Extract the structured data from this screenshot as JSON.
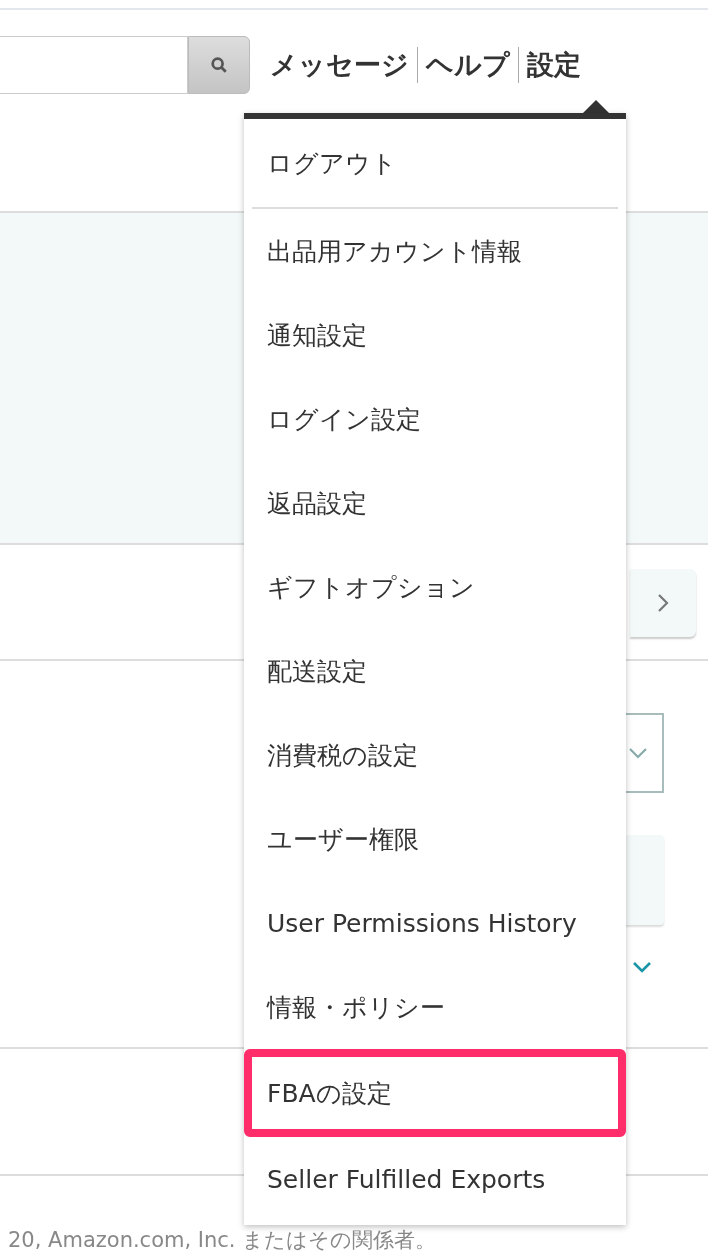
{
  "header": {
    "nav_links": [
      {
        "label": "メッセージ"
      },
      {
        "label": "ヘルプ"
      },
      {
        "label": "設定"
      }
    ]
  },
  "settings_menu": {
    "groups": [
      [
        {
          "label": "ログアウト",
          "selected": false
        }
      ],
      [
        {
          "label": "出品用アカウント情報",
          "selected": false
        },
        {
          "label": "通知設定",
          "selected": false
        },
        {
          "label": "ログイン設定",
          "selected": false
        },
        {
          "label": "返品設定",
          "selected": false
        },
        {
          "label": "ギフトオプション",
          "selected": false
        },
        {
          "label": "配送設定",
          "selected": false
        },
        {
          "label": "消費税の設定",
          "selected": false
        },
        {
          "label": "ユーザー権限",
          "selected": false
        },
        {
          "label": "User Permissions History",
          "selected": false
        },
        {
          "label": "情報・ポリシー",
          "selected": false
        },
        {
          "label": "FBAの設定",
          "selected": true
        },
        {
          "label": "Seller Fulfilled Exports",
          "selected": false
        }
      ]
    ]
  },
  "footer": {
    "copyright": "20, Amazon.com, Inc. またはその関係者。"
  }
}
